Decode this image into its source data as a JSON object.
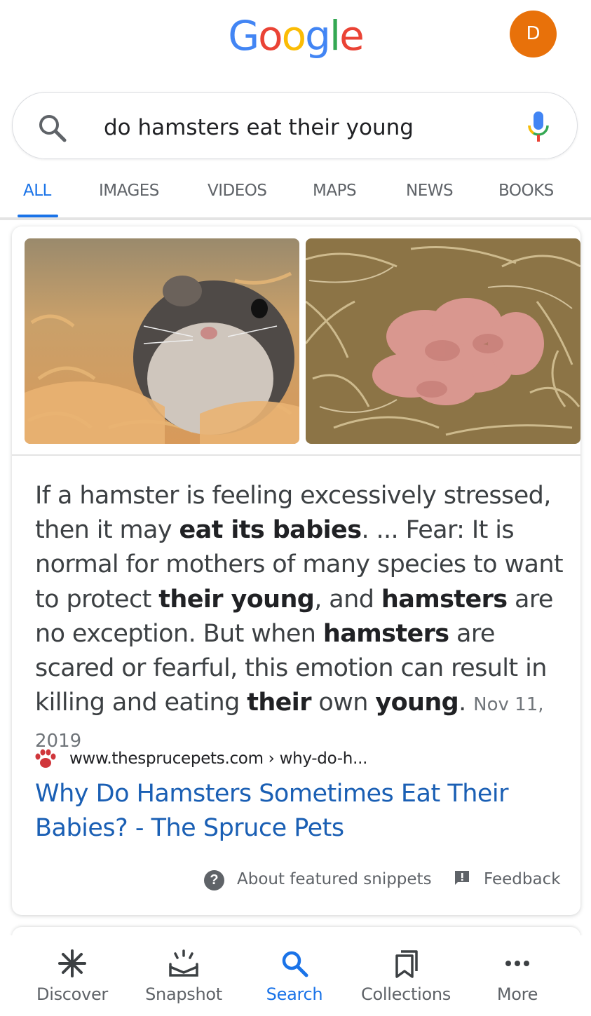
{
  "header": {
    "logo_letters": [
      {
        "char": "G",
        "color": "#4285f4"
      },
      {
        "char": "o",
        "color": "#ea4335"
      },
      {
        "char": "o",
        "color": "#fbbc05"
      },
      {
        "char": "g",
        "color": "#4285f4"
      },
      {
        "char": "l",
        "color": "#34a853"
      },
      {
        "char": "e",
        "color": "#ea4335"
      }
    ],
    "avatar_initial": "D",
    "avatar_color": "#e8710a"
  },
  "search": {
    "query": "do hamsters eat their young",
    "search_icon": "search-icon",
    "mic_icon": "mic-icon"
  },
  "tabs": [
    {
      "label": "ALL",
      "active": true
    },
    {
      "label": "IMAGES",
      "active": false
    },
    {
      "label": "VIDEOS",
      "active": false
    },
    {
      "label": "MAPS",
      "active": false
    },
    {
      "label": "NEWS",
      "active": false
    },
    {
      "label": "BOOKS",
      "active": false
    }
  ],
  "snippet": {
    "text_parts": [
      {
        "t": "If a hamster is feeling excessively stressed, then it may ",
        "b": false
      },
      {
        "t": "eat its babies",
        "b": true
      },
      {
        "t": ". ... Fear: It is normal for mothers of many species to want to protect ",
        "b": false
      },
      {
        "t": "their young",
        "b": true
      },
      {
        "t": ", and ",
        "b": false
      },
      {
        "t": "hamsters",
        "b": true
      },
      {
        "t": " are no exception. But when ",
        "b": false
      },
      {
        "t": "hamsters",
        "b": true
      },
      {
        "t": " are scared or fearful, this emotion can result in killing and eating ",
        "b": false
      },
      {
        "t": "their",
        "b": true
      },
      {
        "t": " own ",
        "b": false
      },
      {
        "t": "young",
        "b": true
      },
      {
        "t": ".",
        "b": false
      }
    ],
    "date": "Nov 11, 2019",
    "images": [
      "hamster-photo",
      "baby-hamsters-photo"
    ]
  },
  "source": {
    "site_icon": "paw-icon",
    "url": "www.thesprucepets.com › why-do-h...",
    "title": "Why Do Hamsters Sometimes Eat Their Babies? - The Spruce Pets",
    "link_color": "#1a5fb4"
  },
  "footer_links": {
    "about": "About featured snippets",
    "feedback": "Feedback"
  },
  "bottom_nav": [
    {
      "label": "Discover",
      "icon": "asterisk-icon",
      "active": false
    },
    {
      "label": "Snapshot",
      "icon": "snapshot-icon",
      "active": false
    },
    {
      "label": "Search",
      "icon": "search-icon",
      "active": true
    },
    {
      "label": "Collections",
      "icon": "collections-icon",
      "active": false
    },
    {
      "label": "More",
      "icon": "more-dots-icon",
      "active": false
    }
  ],
  "accent_color": "#1a73e8"
}
